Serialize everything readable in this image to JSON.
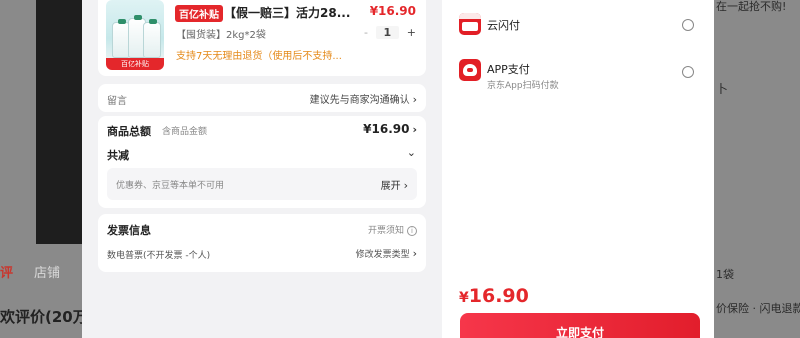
{
  "background": {
    "left_tab_review": "评",
    "left_tab_shop": "店铺",
    "left_footer": "欢评价(20万+",
    "right_line1": "在一起抢不购!",
    "right_line2": "卜",
    "right_line3": "1袋",
    "right_line4": "价保险 · 闪电退款"
  },
  "order": {
    "product": {
      "badge": "百亿补贴",
      "title": "【假一赔三】活力28...",
      "price": "¥16.90",
      "spec": "【囤货装】2kg*2袋",
      "return_policy": "支持7天无理由退货（使用后不支持...",
      "quantity": "1",
      "minus": "-",
      "plus": "+",
      "thumb_tag": "百亿补贴"
    },
    "memo": {
      "label": "留言",
      "value": "建议先与商家沟通确认"
    },
    "total": {
      "label": "商品总额",
      "sub": "含商品金额",
      "price": "¥16.90",
      "reduce_label": "共减",
      "coupon_text": "优惠券、京豆等本单不可用",
      "expand": "展开"
    },
    "invoice": {
      "title": "发票信息",
      "notice": "开票须知",
      "type": "数电普票(不开发票 -个人)",
      "modify": "修改发票类型"
    }
  },
  "payment": {
    "options": [
      {
        "name": "云闪付",
        "sub": ""
      },
      {
        "name": "APP支付",
        "sub": "京东App扫码付款"
      }
    ],
    "currency": "¥",
    "amount": "16.90",
    "button": "立即支付"
  },
  "colors": {
    "accent_red": "#e4272b",
    "warning_orange": "#e58a1a"
  },
  "icons": [
    "chevron-right-icon",
    "chevron-down-icon",
    "info-icon",
    "unionpay-logo",
    "jd-app-logo",
    "radio-icon"
  ]
}
